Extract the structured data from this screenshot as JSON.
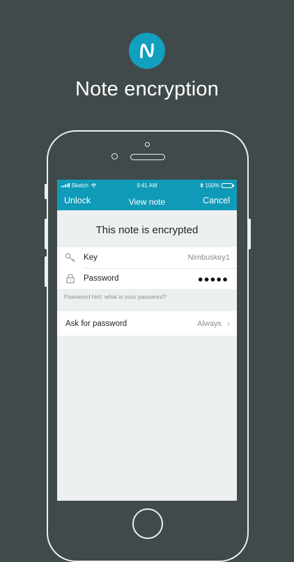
{
  "header": {
    "headline": "Note encryption",
    "logo_letter": "N"
  },
  "status_bar": {
    "carrier": "Sketch",
    "time": "9:41 AM",
    "battery": "100%"
  },
  "navbar": {
    "left": "Unlock",
    "title": "View note",
    "right": "Cancel"
  },
  "content": {
    "title": "This note is encrypted",
    "key_label": "Key",
    "key_value": "Nimbuskey1",
    "password_label": "Password",
    "password_value": "●●●●●",
    "hint": "Password hint: what is your password?",
    "ask_label": "Ask for password",
    "ask_value": "Always"
  },
  "colors": {
    "background": "#414a4a",
    "accent": "#0f9ab8",
    "logo": "#12a0bf"
  },
  "icons": [
    "n-logo-icon",
    "signal-icon",
    "wifi-icon",
    "bluetooth-icon",
    "battery-icon",
    "key-icon",
    "lock-icon",
    "chevron-right-icon"
  ]
}
